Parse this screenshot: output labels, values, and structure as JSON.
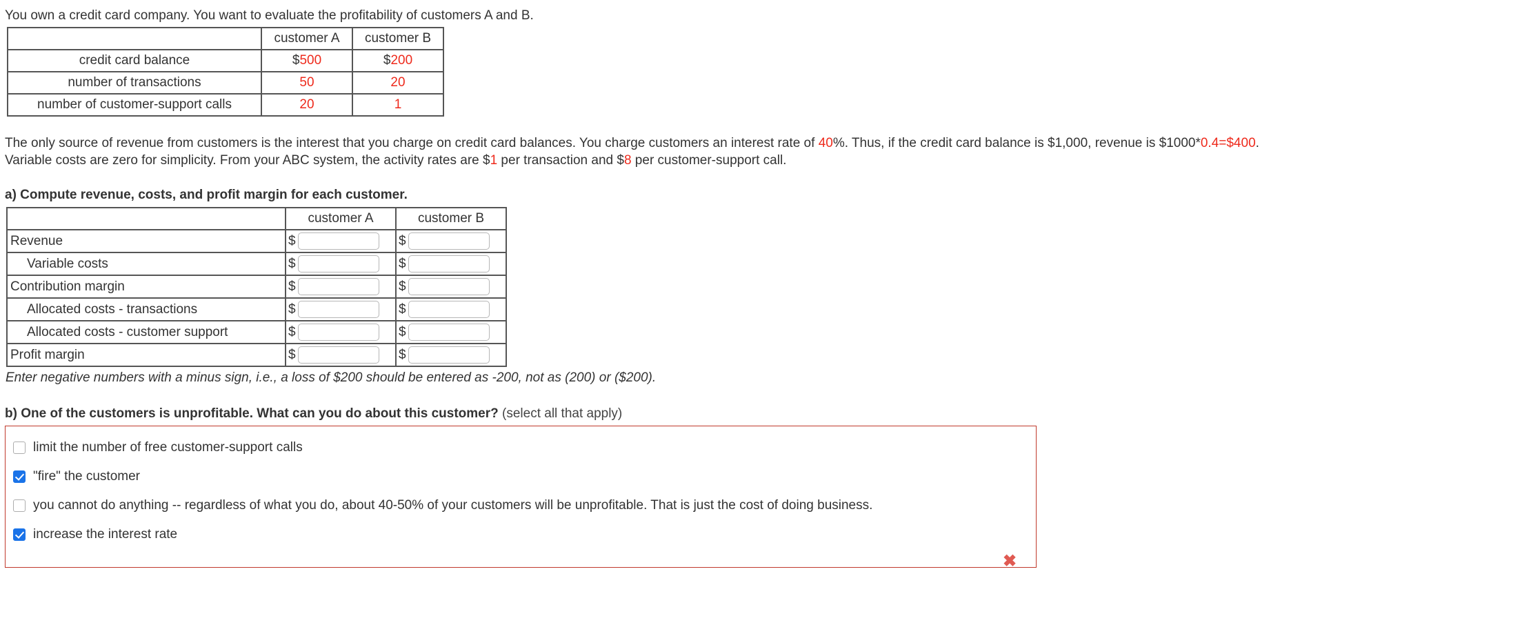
{
  "intro": "You own a credit card company. You want to evaluate the profitability of customers A and B.",
  "given_table": {
    "headers": [
      "",
      "customer A",
      "customer B"
    ],
    "rows": [
      {
        "label": "credit card balance",
        "a_prefix": "$",
        "a_value": "500",
        "b_prefix": "$",
        "b_value": "200"
      },
      {
        "label": "number of transactions",
        "a_prefix": "",
        "a_value": "50",
        "b_prefix": "",
        "b_value": "20"
      },
      {
        "label": "number of customer-support calls",
        "a_prefix": "",
        "a_value": "20",
        "b_prefix": "",
        "b_value": "1"
      }
    ]
  },
  "paragraph": {
    "p1": "The only source of revenue from customers is the interest that you charge on credit card balances. You charge customers an interest rate of ",
    "rate": "40",
    "p2": "%. Thus, if the credit card balance is $1,000, revenue is $1000*",
    "calc": "0.4=$400",
    "p3": ".",
    "p4": "Variable costs are zero for simplicity. From your ABC system, the activity rates are $",
    "rate_transaction": "1",
    "p5": " per transaction and $",
    "rate_support": "8",
    "p6": " per customer-support call."
  },
  "question_a": {
    "heading": "a) Compute revenue, costs, and profit margin for each customer.",
    "headers": [
      "",
      "customer A",
      "customer B"
    ],
    "dollar_sign": "$",
    "rows": [
      {
        "label": "Revenue",
        "indent": false,
        "a_value": "",
        "b_value": ""
      },
      {
        "label": "Variable costs",
        "indent": true,
        "a_value": "",
        "b_value": ""
      },
      {
        "label": "Contribution margin",
        "indent": false,
        "a_value": "",
        "b_value": ""
      },
      {
        "label": "Allocated costs - transactions",
        "indent": true,
        "a_value": "",
        "b_value": ""
      },
      {
        "label": "Allocated costs - customer support",
        "indent": true,
        "a_value": "",
        "b_value": ""
      },
      {
        "label": "Profit margin",
        "indent": false,
        "a_value": "",
        "b_value": ""
      }
    ],
    "note": "Enter negative numbers with a minus sign, i.e., a loss of $200 should be entered as -200, not as (200) or ($200)."
  },
  "question_b": {
    "heading": "b) One of the customers is unprofitable. What can you do about this customer?",
    "subheading": "(select all that apply)",
    "options": [
      {
        "label": "limit the number of free customer-support calls",
        "checked": false
      },
      {
        "label": "\"fire\" the customer",
        "checked": true
      },
      {
        "label": "you cannot do anything -- regardless of what you do, about 40-50% of your customers will be unprofitable. That is just the cost of doing business.",
        "checked": false
      },
      {
        "label": "increase the interest rate",
        "checked": false
      }
    ],
    "status_icon": "✖",
    "status_icon_name": "incorrect-x-icon"
  },
  "colors": {
    "accent_red": "#ee2a1c",
    "box_border_red": "#c0392b",
    "checkbox_blue": "#1a73e8",
    "text": "#333333"
  }
}
